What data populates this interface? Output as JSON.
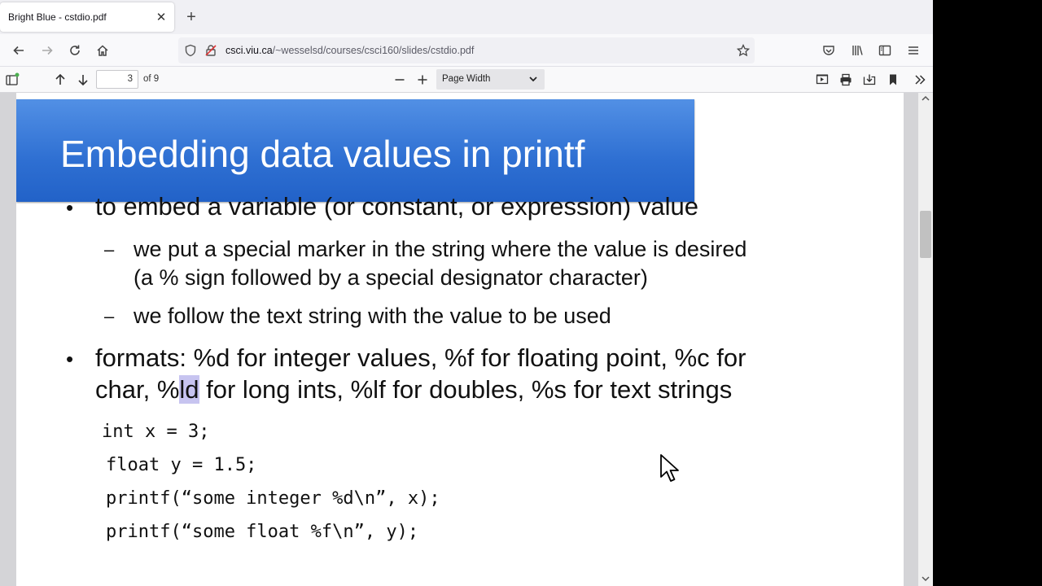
{
  "tab": {
    "title": "Bright Blue - cstdio.pdf",
    "close_glyph": "✕",
    "new_tab_glyph": "+"
  },
  "nav": {
    "url_prefix": "csci.viu.ca",
    "url_path": "/~wesselsd/courses/csci160/slides/cstdio.pdf"
  },
  "pdf_toolbar": {
    "page_number": "3",
    "page_count": "of 9",
    "zoom_label": "Page Width"
  },
  "slide": {
    "title": "Embedding data values in printf",
    "bullets": [
      {
        "text": "to embed a variable (or constant, or expression) value"
      },
      {
        "text": "formats: %d for integer values, %f for floating point, %c for"
      }
    ],
    "bullet2_line2_pre": "char, %",
    "bullet2_line2_highlight": "ld",
    "bullet2_line2_post": " for long ints, %lf for doubles, %s for text strings",
    "subbullets": [
      {
        "line1": "we put a special marker in the string where the value is desired",
        "line2": "(a % sign followed by a special designator character)"
      },
      {
        "line1": "we follow the text string with the value to be used"
      }
    ],
    "bullet_glyph": "•",
    "dash_glyph": "–",
    "code": [
      "int x = 3;",
      "float y = 1.5;",
      "printf(“some integer %d\\n”, x);",
      "printf(“some float %f\\n”, y);"
    ]
  },
  "colors": {
    "banner": "#2e6fd2",
    "highlight": "#c7c4f0"
  },
  "icons": {
    "back": "arrow-left-icon",
    "forward": "arrow-right-icon",
    "reload": "reload-icon",
    "home": "home-icon",
    "shield": "shield-icon",
    "lock": "lock-icon",
    "bookmark_star": "star-icon",
    "pocket": "pocket-icon",
    "library": "library-icon",
    "sidebar": "sidebar-icon",
    "menu": "hamburger-menu-icon",
    "pdf_sidebar": "sidebar-toggle-icon",
    "prev": "arrow-up-icon",
    "next": "arrow-down-icon",
    "zoom_out": "minus-icon",
    "zoom_in": "plus-icon",
    "presentation": "presentation-icon",
    "print": "print-icon",
    "save": "download-icon",
    "bookmark": "bookmark-icon",
    "tools": "double-chevron-icon"
  }
}
